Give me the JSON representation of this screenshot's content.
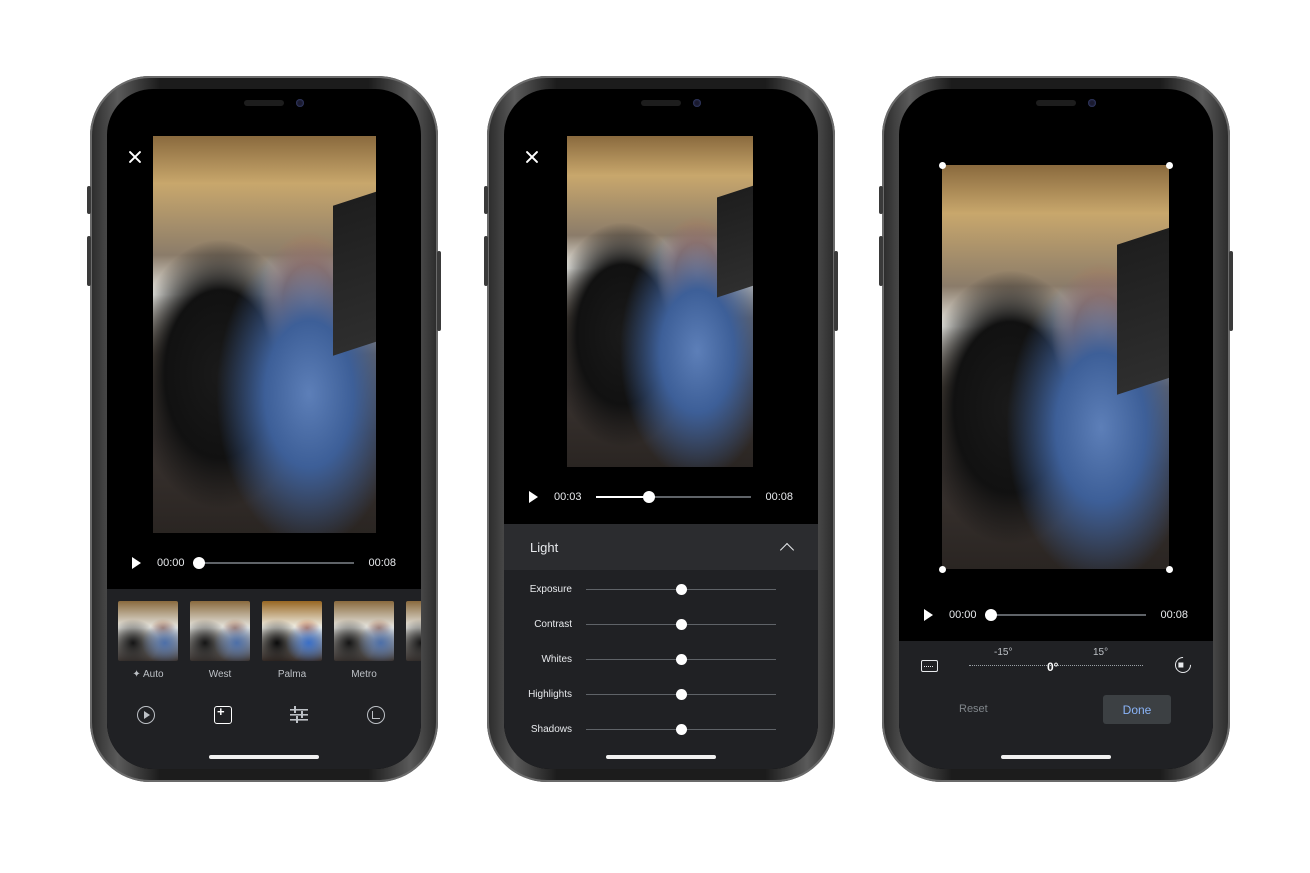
{
  "phone1": {
    "player": {
      "current_time": "00:00",
      "duration": "00:08",
      "progress": 0.0
    },
    "filters": [
      {
        "label": "Auto",
        "icon": "auto-sparkle-icon"
      },
      {
        "label": "West"
      },
      {
        "label": "Palma"
      },
      {
        "label": "Metro"
      }
    ],
    "toolbar": [
      {
        "icon": "play-circle-icon"
      },
      {
        "icon": "filter-edit-icon",
        "active": true
      },
      {
        "icon": "sliders-icon"
      },
      {
        "icon": "crop-rotate-icon"
      }
    ]
  },
  "phone2": {
    "player": {
      "current_time": "00:03",
      "duration": "00:08",
      "progress": 0.34
    },
    "panel": {
      "title": "Light",
      "adjustments": [
        {
          "label": "Exposure",
          "value": 0.5
        },
        {
          "label": "Contrast",
          "value": 0.5
        },
        {
          "label": "Whites",
          "value": 0.5
        },
        {
          "label": "Highlights",
          "value": 0.5
        },
        {
          "label": "Shadows",
          "value": 0.5
        }
      ]
    }
  },
  "phone3": {
    "player": {
      "current_time": "00:00",
      "duration": "00:08",
      "progress": 0.0
    },
    "rotation": {
      "min_label": "-15°",
      "current_label": "0°",
      "max_label": "15°"
    },
    "reset_label": "Reset",
    "done_label": "Done"
  },
  "colors": {
    "panel_bg": "#202124",
    "accent_blue": "#8ab4f8",
    "track": "#5f6368"
  }
}
